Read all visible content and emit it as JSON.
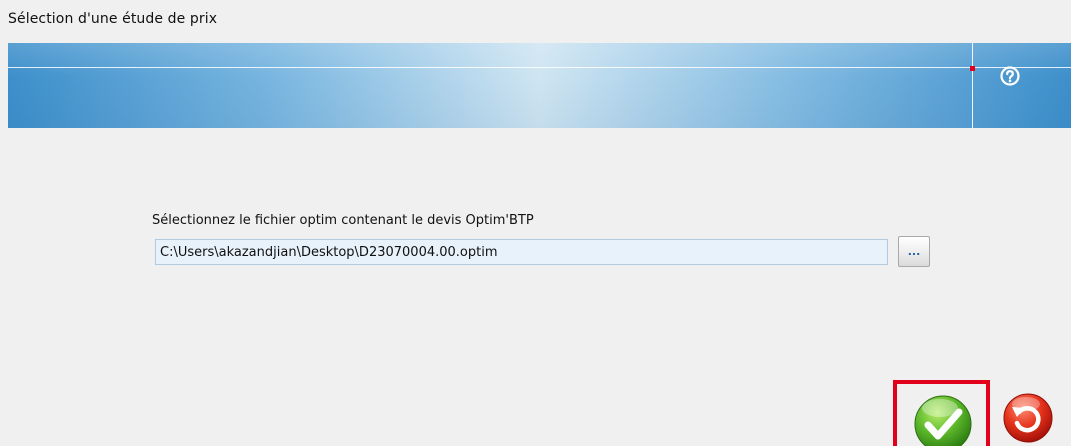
{
  "window": {
    "title": "Sélection d'une étude de prix"
  },
  "banner": {
    "help_icon": "help-question-icon",
    "colors": {
      "gradient_edge": "#3d8fcb",
      "gradient_center": "#cfe5f2",
      "marker": "#e3001b"
    }
  },
  "form": {
    "label": "Sélectionnez le fichier optim contenant le devis Optim'BTP",
    "file_path": "C:\\Users\\akazandjian\\Desktop\\D23070004.00.optim",
    "browse_label": "..."
  },
  "actions": {
    "validate_icon": "green-check-icon",
    "cancel_icon": "red-undo-icon",
    "highlight_color": "#e3001b"
  }
}
